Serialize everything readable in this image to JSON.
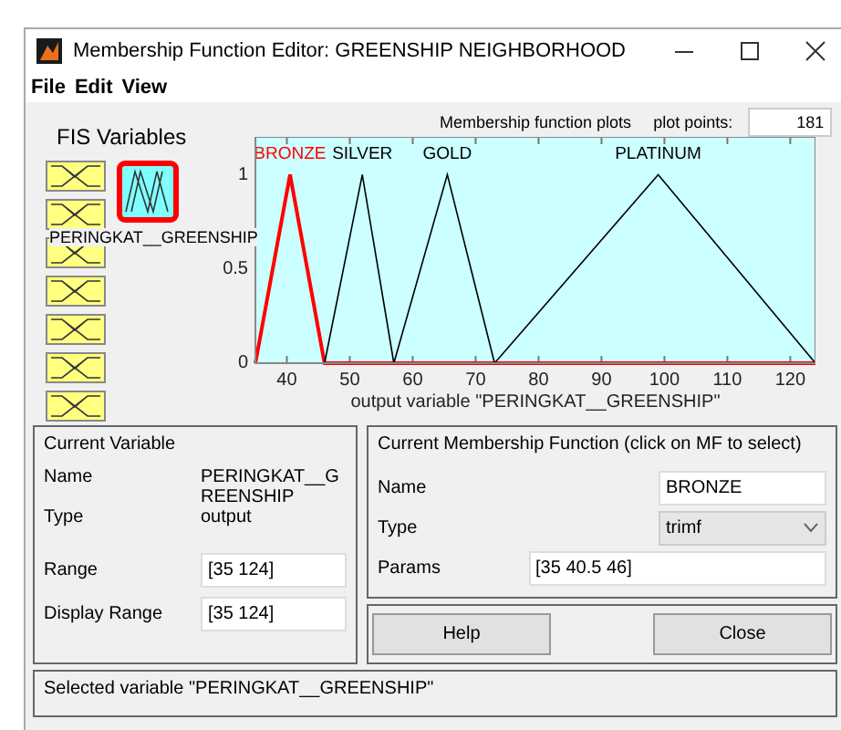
{
  "window": {
    "title": "Membership Function Editor: GREENSHIP NEIGHBORHOOD"
  },
  "menu": [
    "File",
    "Edit",
    "View"
  ],
  "fis_variables": {
    "title": "FIS Variables",
    "inputs": [
      {
        "selected": false
      },
      {
        "selected": false
      },
      {
        "selected": false
      },
      {
        "selected": false
      },
      {
        "selected": false
      },
      {
        "selected": false
      },
      {
        "selected": false
      }
    ],
    "output": {
      "label": "PERINGKAT__GREENSHIP",
      "selected": true
    }
  },
  "plot_header": {
    "title": "Membership function plots",
    "plot_points_label": "plot points:",
    "plot_points": "181"
  },
  "chart_data": {
    "type": "line",
    "xlabel": "output variable \"PERINGKAT__GREENSHIP\"",
    "x": [
      35,
      40.5,
      46,
      52,
      57,
      65.5,
      73,
      99,
      124
    ],
    "series": [
      {
        "name": "BRONZE",
        "color": "#ff0000",
        "values": [
          0,
          1,
          0,
          0,
          0,
          0,
          0,
          0,
          0
        ]
      },
      {
        "name": "SILVER",
        "color": "#000000",
        "values": [
          null,
          null,
          0,
          1,
          0,
          null,
          null,
          null,
          null
        ]
      },
      {
        "name": "GOLD",
        "color": "#000000",
        "values": [
          null,
          null,
          null,
          null,
          0,
          1,
          0,
          null,
          null
        ]
      },
      {
        "name": "PLATINUM",
        "color": "#000000",
        "values": [
          null,
          null,
          null,
          null,
          null,
          null,
          0,
          1,
          0
        ]
      }
    ],
    "xlim": [
      35,
      124
    ],
    "ylim": [
      0,
      1.2
    ],
    "xticks": [
      40,
      50,
      60,
      70,
      80,
      90,
      100,
      110,
      120
    ],
    "yticks": [
      0,
      {
        "value": 0.5,
        "label": "0.5"
      },
      1
    ]
  },
  "current_variable": {
    "title": "Current Variable",
    "name_label": "Name",
    "name": "PERINGKAT__GREENSHIP",
    "type_label": "Type",
    "type": "output",
    "range_label": "Range",
    "range": "[35 124]",
    "display_range_label": "Display Range",
    "display_range": "[35 124]"
  },
  "current_mf": {
    "title": "Current Membership Function (click on MF to select)",
    "name_label": "Name",
    "name": "BRONZE",
    "type_label": "Type",
    "type": "trimf",
    "params_label": "Params",
    "params": "[35 40.5 46]"
  },
  "buttons": [
    "Help",
    "Close"
  ],
  "status": "Selected variable \"PERINGKAT__GREENSHIP\""
}
